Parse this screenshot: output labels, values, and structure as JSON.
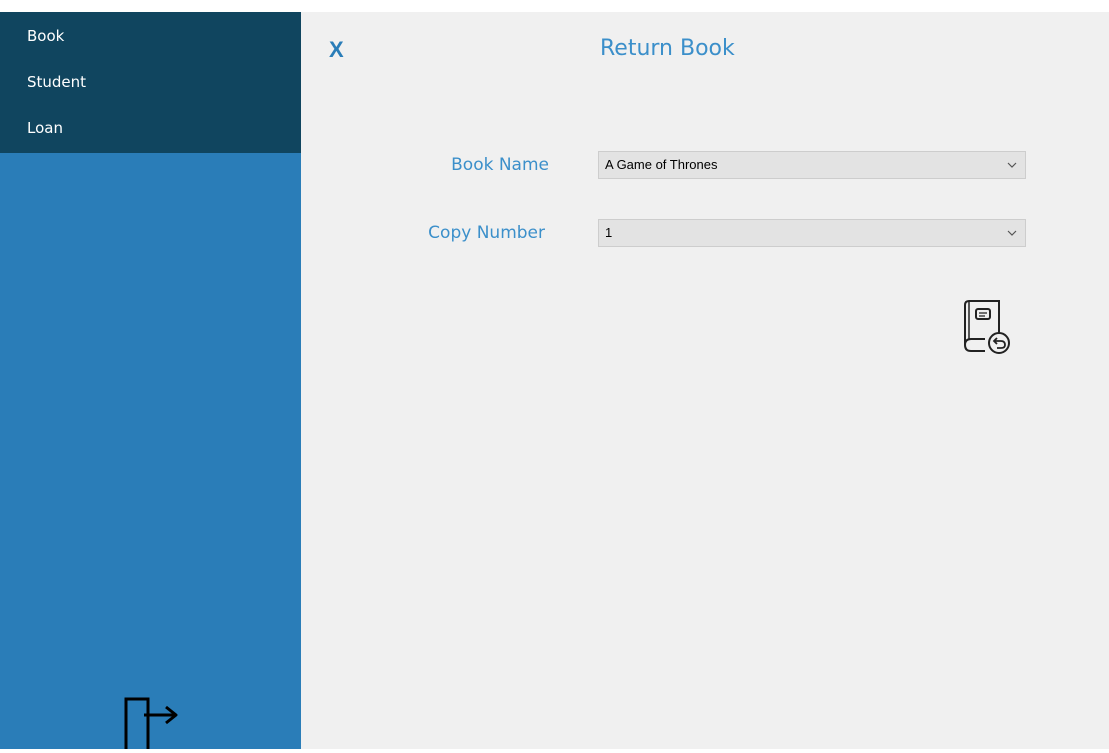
{
  "sidebar": {
    "items": [
      {
        "label": "Book"
      },
      {
        "label": "Student"
      },
      {
        "label": "Loan"
      }
    ],
    "logout_icon": "logout-icon"
  },
  "header": {
    "close_label": "X",
    "title": "Return Book"
  },
  "form": {
    "book_name": {
      "label": "Book Name",
      "value": "A Game of Thrones"
    },
    "copy_number": {
      "label": "Copy Number",
      "value": "1"
    }
  },
  "actions": {
    "return_icon": "book-return-icon"
  },
  "colors": {
    "sidebar": "#2a7db8",
    "nav": "#10455f",
    "accent": "#3b8fca",
    "background": "#f0f0f0"
  }
}
